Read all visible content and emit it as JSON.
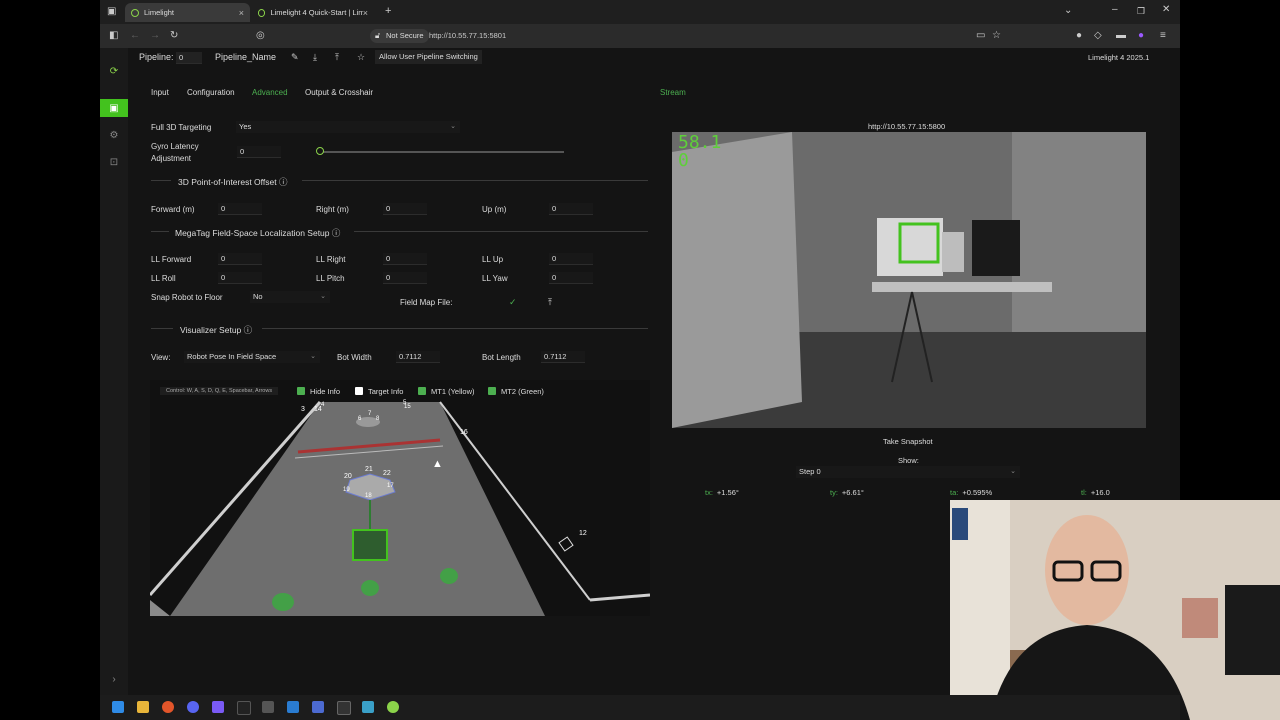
{
  "browser": {
    "tabs": [
      {
        "title": "Limelight",
        "active": true
      },
      {
        "title": "Limelight 4 Quick-Start | Limeli",
        "active": false
      }
    ],
    "not_secure": "Not Secure",
    "url": "http://10.55.77.15:5801"
  },
  "topbar": {
    "pipeline_label": "Pipeline:",
    "pipeline_index": "0",
    "pipeline_name": "Pipeline_Name",
    "allow_switching": "Allow User Pipeline Switching",
    "version": "Limelight 4 2025.1"
  },
  "tabs": [
    "Input",
    "Configuration",
    "Advanced",
    "Output & Crosshair"
  ],
  "active_tab": "Advanced",
  "stream_tab": "Stream",
  "advanced": {
    "full3d_label": "Full 3D Targeting",
    "full3d_value": "Yes",
    "gyro_label_1": "Gyro Latency",
    "gyro_label_2": "Adjustment",
    "gyro_value": "0",
    "poi_section": "3D Point-of-Interest Offset",
    "forward_label": "Forward (m)",
    "forward_value": "0",
    "right_label": "Right (m)",
    "right_value": "0",
    "up_label": "Up (m)",
    "up_value": "0",
    "megatag_section": "MegaTag Field-Space Localization Setup",
    "ll_forward_label": "LL Forward",
    "ll_forward_value": "0",
    "ll_right_label": "LL Right",
    "ll_right_value": "0",
    "ll_up_label": "LL Up",
    "ll_up_value": "0",
    "ll_roll_label": "LL Roll",
    "ll_roll_value": "0",
    "ll_pitch_label": "LL Pitch",
    "ll_pitch_value": "0",
    "ll_yaw_label": "LL Yaw",
    "ll_yaw_value": "0",
    "snap_label": "Snap Robot to Floor",
    "snap_value": "No",
    "field_map_label": "Field Map File:",
    "field_map_check": "✓",
    "vis_section": "Visualizer Setup",
    "view_label": "View:",
    "view_value": "Robot Pose In Field Space",
    "bot_width_label": "Bot Width",
    "bot_width_value": "0.7112",
    "bot_length_label": "Bot Length",
    "bot_length_value": "0.7112"
  },
  "visualizer": {
    "controls_hint": "Control: W, A, S, D, Q, E, Spacebar, Arrows",
    "hide_info": "Hide Info",
    "hide_info_checked": true,
    "target_info": "Target Info",
    "target_info_checked": false,
    "mt1": "MT1 (Yellow)",
    "mt1_checked": true,
    "mt2": "MT2 (Green)",
    "mt2_checked": true,
    "tag_ids": [
      "3",
      "14",
      "4",
      "5",
      "15",
      "6",
      "7",
      "8",
      "16",
      "20",
      "21",
      "22",
      "19",
      "17",
      "18",
      "12"
    ]
  },
  "stream": {
    "url": "http://10.55.77.15:5800",
    "fps": "58.1",
    "fps_sub": "0",
    "snapshot": "Take Snapshot",
    "show_label": "Show:",
    "show_value": "Step 0",
    "stats": [
      {
        "key": "tx:",
        "value": "+1.56°"
      },
      {
        "key": "ty:",
        "value": "+6.61°"
      },
      {
        "key": "ta:",
        "value": "+0.595%"
      },
      {
        "key": "tl:",
        "value": "+16.0"
      }
    ]
  },
  "colors": {
    "accent": "#4caf50",
    "sidebar_active": "#43c21e",
    "bg": "#141414"
  }
}
